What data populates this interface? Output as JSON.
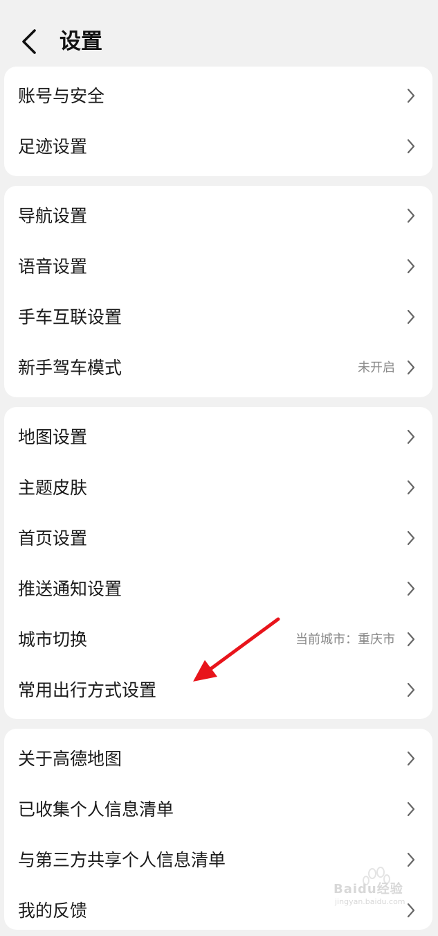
{
  "header": {
    "title": "设置"
  },
  "groups": [
    {
      "items": [
        {
          "label": "账号与安全"
        },
        {
          "label": "足迹设置"
        }
      ]
    },
    {
      "items": [
        {
          "label": "导航设置"
        },
        {
          "label": "语音设置"
        },
        {
          "label": "手车互联设置"
        },
        {
          "label": "新手驾车模式",
          "value": "未开启"
        }
      ]
    },
    {
      "items": [
        {
          "label": "地图设置"
        },
        {
          "label": "主题皮肤"
        },
        {
          "label": "首页设置"
        },
        {
          "label": "推送通知设置"
        },
        {
          "label": "城市切换",
          "value": "当前城市：重庆市"
        },
        {
          "label": "常用出行方式设置"
        }
      ]
    },
    {
      "items": [
        {
          "label": "关于高德地图"
        },
        {
          "label": "已收集个人信息清单"
        },
        {
          "label": "与第三方共享个人信息清单"
        },
        {
          "label": "我的反馈"
        }
      ]
    }
  ],
  "watermark": {
    "text": "Baidu经验",
    "sub": "jingyan.baidu.com"
  },
  "colors": {
    "annotation_arrow": "#e8141b",
    "background": "#f1f1f1",
    "card": "#ffffff"
  }
}
